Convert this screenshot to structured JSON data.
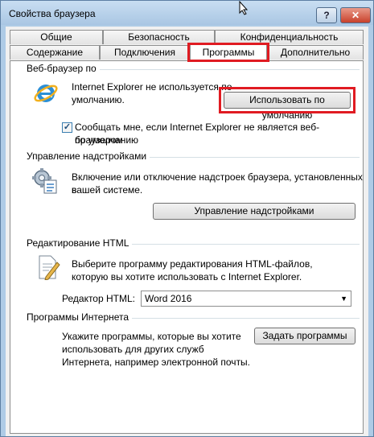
{
  "window": {
    "title": "Свойства браузера",
    "help_label": "?",
    "close_label": "✕"
  },
  "tabs": {
    "top_row": [
      "Общие",
      "Безопасность",
      "Конфиденциальность"
    ],
    "bottom_row": [
      "Содержание",
      "Подключения",
      "Программы",
      "Дополнительно"
    ],
    "active": "Программы"
  },
  "default_browser": {
    "heading": "Веб-браузер по",
    "status_line1": "Internet Explorer не используется по",
    "status_line2": "умолчанию.",
    "button_label": "Использовать по умолчанию",
    "checkbox_checked": true,
    "checkbox_line1": "Сообщать мне, если Internet Explorer не является веб-браузером",
    "checkbox_line2": "по умолчанию"
  },
  "addons": {
    "heading": "Управление надстройками",
    "desc_line1": "Включение или отключение надстроек браузера, установленных в",
    "desc_line2": "вашей системе.",
    "button_label": "Управление надстройками"
  },
  "html_editing": {
    "heading": "Редактирование HTML",
    "desc_line1": "Выберите программу редактирования HTML-файлов,",
    "desc_line2": "которую вы хотите использовать с Internet Explorer.",
    "editor_label": "Редактор HTML:",
    "editor_value": "Word 2016"
  },
  "internet_programs": {
    "heading": "Программы Интернета",
    "desc_line1": "Укажите программы, которые вы хотите",
    "desc_line2": "использовать для других служб",
    "desc_line3": "Интернета, например электронной почты.",
    "button_label": "Задать программы"
  },
  "colors": {
    "highlight": "#e01b22",
    "titlebar": "#aecbe6",
    "close": "#c8412b"
  }
}
